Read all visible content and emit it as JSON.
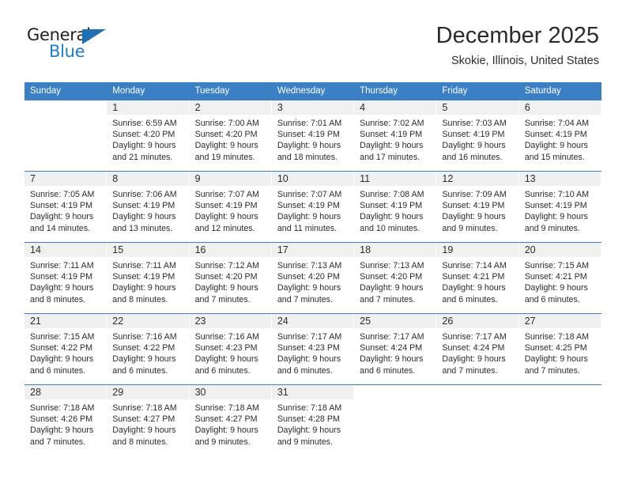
{
  "brand": {
    "word_one": "General",
    "word_two": "Blue",
    "triangle_color": "#1f6fb5",
    "blue_color": "#1f7ec4"
  },
  "header": {
    "title": "December 2025",
    "subtitle": "Skokie, Illinois, United States"
  },
  "theme": {
    "header_bg": "#3b7fc4",
    "daynum_band_bg": "#f0f0f0",
    "text_color": "#2b2b2b"
  },
  "weekdays": [
    "Sunday",
    "Monday",
    "Tuesday",
    "Wednesday",
    "Thursday",
    "Friday",
    "Saturday"
  ],
  "weeks": [
    [
      {
        "day": "",
        "lines": [
          "",
          "",
          "",
          ""
        ]
      },
      {
        "day": "1",
        "lines": [
          "Sunrise: 6:59 AM",
          "Sunset: 4:20 PM",
          "Daylight: 9 hours",
          "and 21 minutes."
        ]
      },
      {
        "day": "2",
        "lines": [
          "Sunrise: 7:00 AM",
          "Sunset: 4:20 PM",
          "Daylight: 9 hours",
          "and 19 minutes."
        ]
      },
      {
        "day": "3",
        "lines": [
          "Sunrise: 7:01 AM",
          "Sunset: 4:19 PM",
          "Daylight: 9 hours",
          "and 18 minutes."
        ]
      },
      {
        "day": "4",
        "lines": [
          "Sunrise: 7:02 AM",
          "Sunset: 4:19 PM",
          "Daylight: 9 hours",
          "and 17 minutes."
        ]
      },
      {
        "day": "5",
        "lines": [
          "Sunrise: 7:03 AM",
          "Sunset: 4:19 PM",
          "Daylight: 9 hours",
          "and 16 minutes."
        ]
      },
      {
        "day": "6",
        "lines": [
          "Sunrise: 7:04 AM",
          "Sunset: 4:19 PM",
          "Daylight: 9 hours",
          "and 15 minutes."
        ]
      }
    ],
    [
      {
        "day": "7",
        "lines": [
          "Sunrise: 7:05 AM",
          "Sunset: 4:19 PM",
          "Daylight: 9 hours",
          "and 14 minutes."
        ]
      },
      {
        "day": "8",
        "lines": [
          "Sunrise: 7:06 AM",
          "Sunset: 4:19 PM",
          "Daylight: 9 hours",
          "and 13 minutes."
        ]
      },
      {
        "day": "9",
        "lines": [
          "Sunrise: 7:07 AM",
          "Sunset: 4:19 PM",
          "Daylight: 9 hours",
          "and 12 minutes."
        ]
      },
      {
        "day": "10",
        "lines": [
          "Sunrise: 7:07 AM",
          "Sunset: 4:19 PM",
          "Daylight: 9 hours",
          "and 11 minutes."
        ]
      },
      {
        "day": "11",
        "lines": [
          "Sunrise: 7:08 AM",
          "Sunset: 4:19 PM",
          "Daylight: 9 hours",
          "and 10 minutes."
        ]
      },
      {
        "day": "12",
        "lines": [
          "Sunrise: 7:09 AM",
          "Sunset: 4:19 PM",
          "Daylight: 9 hours",
          "and 9 minutes."
        ]
      },
      {
        "day": "13",
        "lines": [
          "Sunrise: 7:10 AM",
          "Sunset: 4:19 PM",
          "Daylight: 9 hours",
          "and 9 minutes."
        ]
      }
    ],
    [
      {
        "day": "14",
        "lines": [
          "Sunrise: 7:11 AM",
          "Sunset: 4:19 PM",
          "Daylight: 9 hours",
          "and 8 minutes."
        ]
      },
      {
        "day": "15",
        "lines": [
          "Sunrise: 7:11 AM",
          "Sunset: 4:19 PM",
          "Daylight: 9 hours",
          "and 8 minutes."
        ]
      },
      {
        "day": "16",
        "lines": [
          "Sunrise: 7:12 AM",
          "Sunset: 4:20 PM",
          "Daylight: 9 hours",
          "and 7 minutes."
        ]
      },
      {
        "day": "17",
        "lines": [
          "Sunrise: 7:13 AM",
          "Sunset: 4:20 PM",
          "Daylight: 9 hours",
          "and 7 minutes."
        ]
      },
      {
        "day": "18",
        "lines": [
          "Sunrise: 7:13 AM",
          "Sunset: 4:20 PM",
          "Daylight: 9 hours",
          "and 7 minutes."
        ]
      },
      {
        "day": "19",
        "lines": [
          "Sunrise: 7:14 AM",
          "Sunset: 4:21 PM",
          "Daylight: 9 hours",
          "and 6 minutes."
        ]
      },
      {
        "day": "20",
        "lines": [
          "Sunrise: 7:15 AM",
          "Sunset: 4:21 PM",
          "Daylight: 9 hours",
          "and 6 minutes."
        ]
      }
    ],
    [
      {
        "day": "21",
        "lines": [
          "Sunrise: 7:15 AM",
          "Sunset: 4:22 PM",
          "Daylight: 9 hours",
          "and 6 minutes."
        ]
      },
      {
        "day": "22",
        "lines": [
          "Sunrise: 7:16 AM",
          "Sunset: 4:22 PM",
          "Daylight: 9 hours",
          "and 6 minutes."
        ]
      },
      {
        "day": "23",
        "lines": [
          "Sunrise: 7:16 AM",
          "Sunset: 4:23 PM",
          "Daylight: 9 hours",
          "and 6 minutes."
        ]
      },
      {
        "day": "24",
        "lines": [
          "Sunrise: 7:17 AM",
          "Sunset: 4:23 PM",
          "Daylight: 9 hours",
          "and 6 minutes."
        ]
      },
      {
        "day": "25",
        "lines": [
          "Sunrise: 7:17 AM",
          "Sunset: 4:24 PM",
          "Daylight: 9 hours",
          "and 6 minutes."
        ]
      },
      {
        "day": "26",
        "lines": [
          "Sunrise: 7:17 AM",
          "Sunset: 4:24 PM",
          "Daylight: 9 hours",
          "and 7 minutes."
        ]
      },
      {
        "day": "27",
        "lines": [
          "Sunrise: 7:18 AM",
          "Sunset: 4:25 PM",
          "Daylight: 9 hours",
          "and 7 minutes."
        ]
      }
    ],
    [
      {
        "day": "28",
        "lines": [
          "Sunrise: 7:18 AM",
          "Sunset: 4:26 PM",
          "Daylight: 9 hours",
          "and 7 minutes."
        ]
      },
      {
        "day": "29",
        "lines": [
          "Sunrise: 7:18 AM",
          "Sunset: 4:27 PM",
          "Daylight: 9 hours",
          "and 8 minutes."
        ]
      },
      {
        "day": "30",
        "lines": [
          "Sunrise: 7:18 AM",
          "Sunset: 4:27 PM",
          "Daylight: 9 hours",
          "and 9 minutes."
        ]
      },
      {
        "day": "31",
        "lines": [
          "Sunrise: 7:18 AM",
          "Sunset: 4:28 PM",
          "Daylight: 9 hours",
          "and 9 minutes."
        ]
      },
      {
        "day": "",
        "lines": [
          "",
          "",
          "",
          ""
        ]
      },
      {
        "day": "",
        "lines": [
          "",
          "",
          "",
          ""
        ]
      },
      {
        "day": "",
        "lines": [
          "",
          "",
          "",
          ""
        ]
      }
    ]
  ]
}
